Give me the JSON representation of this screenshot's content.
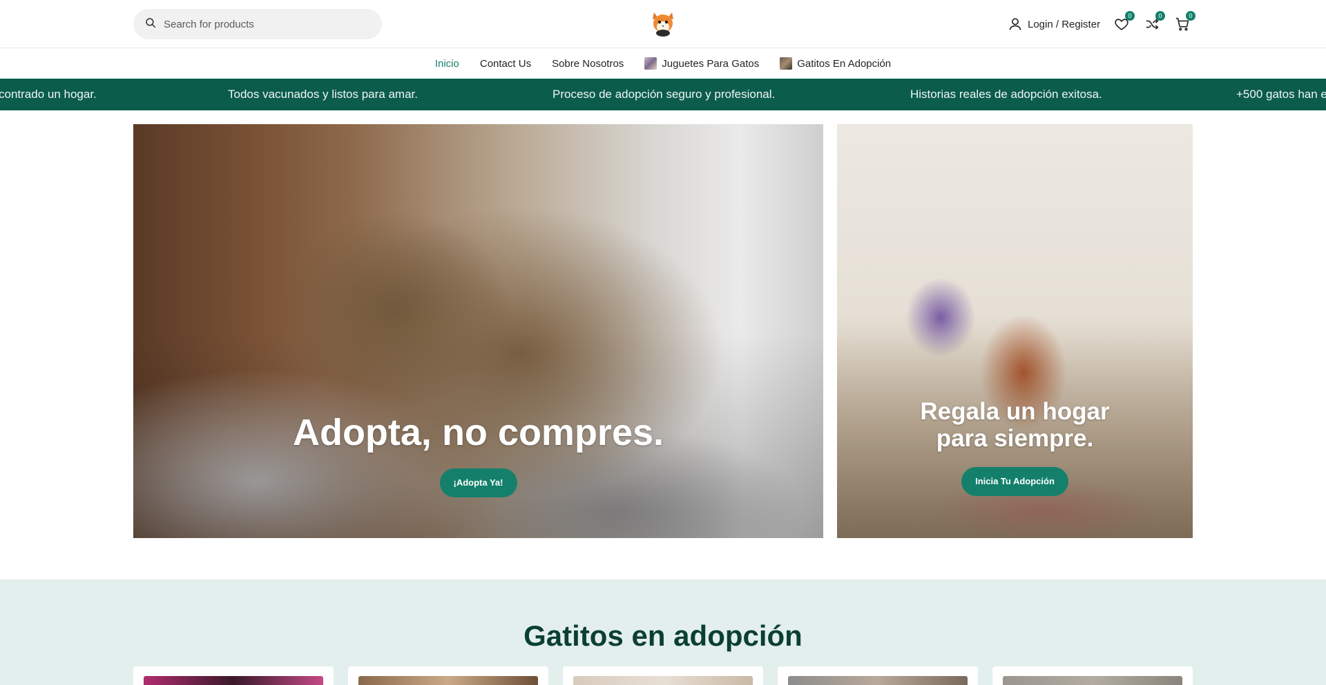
{
  "header": {
    "search_placeholder": "Search for products",
    "login_label": "Login / Register",
    "wishlist_count": "0",
    "compare_count": "0",
    "cart_count": "0"
  },
  "nav": {
    "items": [
      {
        "label": "Inicio"
      },
      {
        "label": "Contact Us"
      },
      {
        "label": "Sobre Nosotros"
      },
      {
        "label": "Juguetes Para Gatos"
      },
      {
        "label": "Gatitos En Adopción"
      }
    ]
  },
  "marquee": {
    "items": [
      "contrado un hogar.",
      "Todos vacunados y listos para amar.",
      "Proceso de adopción seguro y profesional.",
      "Historias reales de adopción exitosa.",
      "+500 gatos han e"
    ]
  },
  "banners": {
    "left": {
      "title": "Adopta, no compres.",
      "button": "¡Adopta Ya!"
    },
    "right": {
      "title": "Regala un hogar para siempre.",
      "button": "Inicia Tu Adopción"
    }
  },
  "adoption": {
    "title": "Gatitos en adopción"
  },
  "colors": {
    "accent": "#14806b",
    "marquee_bg": "#0b5c4b",
    "section_bg": "#e3efec",
    "section_title": "#0b3f34"
  }
}
